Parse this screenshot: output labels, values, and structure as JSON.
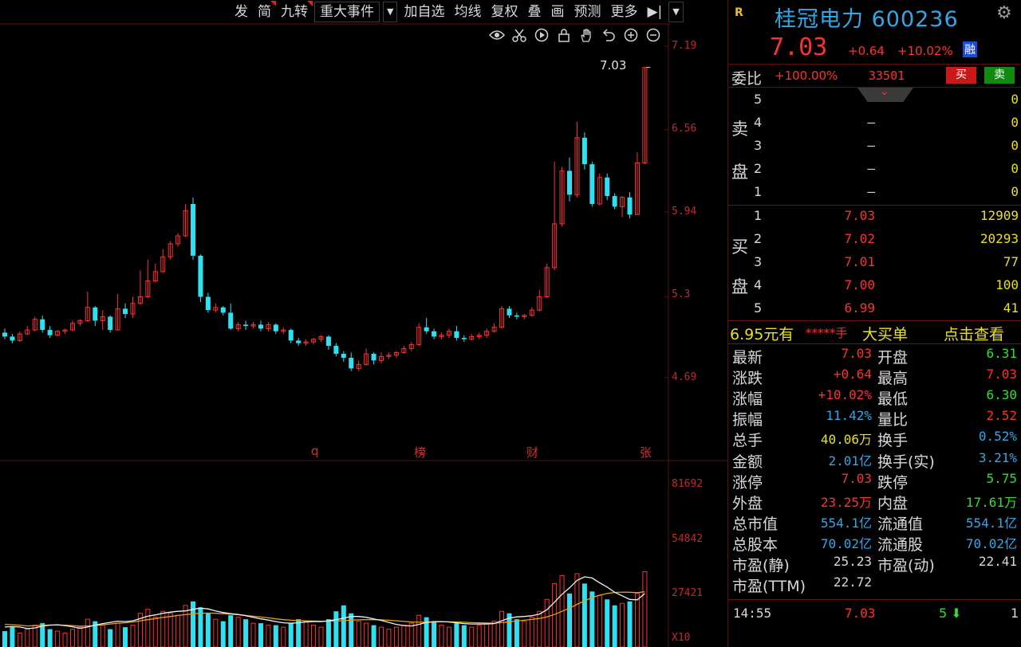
{
  "toolbar": {
    "items": [
      "发",
      "简",
      "九转",
      "重大事件",
      "加自选",
      "均线",
      "复权",
      "叠",
      "画",
      "预测",
      "更多"
    ],
    "dropdown": "▼",
    "jump": "▶|"
  },
  "icons": [
    "eye-icon",
    "scissors-icon",
    "play-icon",
    "lock-icon",
    "hand-icon",
    "undo-icon",
    "zoom-in-icon",
    "zoom-out-icon"
  ],
  "chart_data": {
    "type": "candlestick",
    "price_axis": [
      7.19,
      6.56,
      5.94,
      5.3,
      4.69
    ],
    "volume_axis": [
      "81692",
      "54842",
      "27421",
      "X10"
    ],
    "current_price_tag": "7.03",
    "events": [
      "q",
      "榜",
      "财",
      "张"
    ],
    "candles": [
      [
        5.03,
        5.0,
        5.06,
        4.98
      ],
      [
        5.0,
        4.97,
        5.02,
        4.95
      ],
      [
        4.97,
        5.02,
        5.04,
        4.96
      ],
      [
        5.02,
        5.05,
        5.08,
        5.01
      ],
      [
        5.05,
        5.13,
        5.15,
        5.04
      ],
      [
        5.13,
        5.05,
        5.16,
        5.03
      ],
      [
        5.05,
        5.01,
        5.08,
        4.99
      ],
      [
        5.01,
        5.04,
        5.05,
        5.0
      ],
      [
        5.04,
        5.05,
        5.06,
        5.02
      ],
      [
        5.05,
        5.1,
        5.12,
        5.04
      ],
      [
        5.1,
        5.12,
        5.13,
        5.08
      ],
      [
        5.12,
        5.22,
        5.34,
        5.11
      ],
      [
        5.22,
        5.12,
        5.23,
        5.08
      ],
      [
        5.12,
        5.15,
        5.2,
        5.05
      ],
      [
        5.15,
        5.05,
        5.16,
        5.03
      ],
      [
        5.05,
        5.21,
        5.32,
        5.05
      ],
      [
        5.21,
        5.17,
        5.25,
        5.14
      ],
      [
        5.17,
        5.25,
        5.3,
        5.14
      ],
      [
        5.25,
        5.3,
        5.5,
        5.24
      ],
      [
        5.3,
        5.42,
        5.58,
        5.29
      ],
      [
        5.42,
        5.49,
        5.55,
        5.41
      ],
      [
        5.49,
        5.6,
        5.66,
        5.48
      ],
      [
        5.6,
        5.7,
        5.72,
        5.58
      ],
      [
        5.7,
        5.76,
        5.78,
        5.68
      ],
      [
        5.76,
        5.95,
        6.0,
        5.75
      ],
      [
        6.0,
        5.61,
        6.05,
        5.58
      ],
      [
        5.61,
        5.3,
        5.62,
        5.26
      ],
      [
        5.3,
        5.2,
        5.33,
        5.18
      ],
      [
        5.2,
        5.22,
        5.25,
        5.18
      ],
      [
        5.22,
        5.18,
        5.23,
        5.16
      ],
      [
        5.18,
        5.06,
        5.25,
        5.05
      ],
      [
        5.06,
        5.09,
        5.11,
        5.04
      ],
      [
        5.09,
        5.08,
        5.12,
        5.05
      ],
      [
        5.08,
        5.09,
        5.11,
        5.06
      ],
      [
        5.09,
        5.06,
        5.12,
        5.04
      ],
      [
        5.06,
        5.09,
        5.11,
        5.04
      ],
      [
        5.09,
        5.04,
        5.1,
        5.02
      ],
      [
        5.04,
        5.05,
        5.07,
        5.02
      ],
      [
        5.05,
        4.97,
        5.06,
        4.95
      ],
      [
        4.97,
        4.95,
        4.99,
        4.93
      ],
      [
        4.95,
        4.96,
        4.98,
        4.93
      ],
      [
        4.96,
        4.98,
        4.99,
        4.94
      ],
      [
        4.98,
        5.0,
        5.01,
        4.96
      ],
      [
        5.0,
        4.93,
        5.01,
        4.9
      ],
      [
        4.93,
        4.87,
        4.95,
        4.85
      ],
      [
        4.87,
        4.84,
        4.89,
        4.81
      ],
      [
        4.84,
        4.76,
        4.88,
        4.74
      ],
      [
        4.76,
        4.79,
        4.82,
        4.74
      ],
      [
        4.79,
        4.87,
        4.91,
        4.78
      ],
      [
        4.87,
        4.82,
        4.88,
        4.79
      ],
      [
        4.82,
        4.85,
        4.88,
        4.8
      ],
      [
        4.85,
        4.86,
        4.88,
        4.83
      ],
      [
        4.86,
        4.88,
        4.89,
        4.84
      ],
      [
        4.88,
        4.91,
        4.93,
        4.87
      ],
      [
        4.91,
        4.94,
        4.96,
        4.89
      ],
      [
        4.94,
        5.07,
        5.1,
        4.93
      ],
      [
        5.07,
        5.04,
        5.14,
        5.02
      ],
      [
        5.04,
        5.0,
        5.06,
        4.98
      ],
      [
        5.0,
        5.01,
        5.03,
        4.98
      ],
      [
        5.01,
        5.04,
        5.06,
        4.99
      ],
      [
        5.04,
        4.99,
        5.08,
        4.97
      ],
      [
        4.99,
        4.98,
        5.01,
        4.96
      ],
      [
        4.98,
        5.0,
        5.02,
        4.97
      ],
      [
        5.0,
        5.01,
        5.03,
        4.98
      ],
      [
        5.01,
        5.04,
        5.06,
        4.99
      ],
      [
        5.04,
        5.07,
        5.1,
        5.03
      ],
      [
        5.07,
        5.21,
        5.23,
        5.06
      ],
      [
        5.21,
        5.16,
        5.23,
        5.14
      ],
      [
        5.16,
        5.15,
        5.18,
        5.13
      ],
      [
        5.15,
        5.16,
        5.17,
        5.13
      ],
      [
        5.16,
        5.2,
        5.22,
        5.15
      ],
      [
        5.2,
        5.3,
        5.35,
        5.19
      ],
      [
        5.3,
        5.52,
        5.55,
        5.29
      ],
      [
        5.52,
        5.85,
        6.32,
        5.5
      ],
      [
        5.85,
        6.25,
        6.28,
        5.83
      ],
      [
        6.25,
        6.07,
        6.35,
        6.02
      ],
      [
        6.07,
        6.5,
        6.62,
        6.05
      ],
      [
        6.5,
        6.3,
        6.54,
        6.26
      ],
      [
        6.3,
        6.0,
        6.32,
        5.98
      ],
      [
        6.0,
        6.2,
        6.23,
        5.99
      ],
      [
        6.2,
        6.06,
        6.23,
        6.03
      ],
      [
        6.06,
        5.98,
        6.08,
        5.96
      ],
      [
        5.98,
        6.05,
        6.06,
        5.9
      ],
      [
        6.05,
        5.92,
        6.09,
        5.89
      ],
      [
        5.92,
        6.31,
        6.39,
        5.92
      ],
      [
        6.31,
        7.03,
        7.03,
        6.3
      ]
    ],
    "volumes": [
      8,
      10,
      7,
      9,
      11,
      12,
      9,
      8,
      7,
      9,
      10,
      14,
      13,
      11,
      9,
      12,
      10,
      11,
      17,
      19,
      15,
      18,
      17,
      16,
      21,
      23,
      20,
      17,
      14,
      13,
      16,
      15,
      14,
      12,
      12,
      11,
      11,
      10,
      12,
      14,
      13,
      11,
      10,
      14,
      18,
      21,
      17,
      13,
      12,
      11,
      10,
      9,
      10,
      11,
      12,
      16,
      15,
      13,
      11,
      10,
      12,
      11,
      10,
      11,
      12,
      13,
      18,
      17,
      14,
      13,
      15,
      18,
      24,
      32,
      36,
      27,
      37,
      32,
      28,
      26,
      24,
      21,
      22,
      23,
      27,
      38
    ],
    "ma_short": [
      10.1,
      10.3,
      10.1,
      9.3,
      9.6,
      10.6,
      11.0,
      11.2,
      10.8,
      10.2,
      9.4,
      10.1,
      11.0,
      11.8,
      12.4,
      13.0,
      12.8,
      13.2,
      14.4,
      15.6,
      16.2,
      17.0,
      17.6,
      18.0,
      18.2,
      19.0,
      19.6,
      19.2,
      18.2,
      17.4,
      16.8,
      16.4,
      15.8,
      15.0,
      14.2,
      13.6,
      12.8,
      12.2,
      12.0,
      12.2,
      12.6,
      12.8,
      12.8,
      13.2,
      13.8,
      14.6,
      15.4,
      15.4,
      15.0,
      14.2,
      13.4,
      12.4,
      11.4,
      10.8,
      10.6,
      11.4,
      12.4,
      12.8,
      12.8,
      12.6,
      12.2,
      11.8,
      11.6,
      11.6,
      11.6,
      11.8,
      13.2,
      14.6,
      15.2,
      15.4,
      15.8,
      16.6,
      18.8,
      22.6,
      26.6,
      29.8,
      33.6,
      35.4,
      34.8,
      32.4,
      30.2,
      27.6,
      25.8,
      24.0,
      23.8,
      27.0
    ],
    "ma_long": [
      11.4,
      11.2,
      11.0,
      10.6,
      10.8,
      10.9,
      11.1,
      11.1,
      11.0,
      10.8,
      10.5,
      10.6,
      10.8,
      11.2,
      11.6,
      12.0,
      12.2,
      12.6,
      13.2,
      13.8,
      14.3,
      14.9,
      15.4,
      15.9,
      16.3,
      16.7,
      17.0,
      17.1,
      17.0,
      16.8,
      16.6,
      16.3,
      15.9,
      15.5,
      15.1,
      14.7,
      14.2,
      13.8,
      13.5,
      13.3,
      13.2,
      13.1,
      13.0,
      13.0,
      13.1,
      13.3,
      13.5,
      13.7,
      13.8,
      13.8,
      13.7,
      13.5,
      13.2,
      12.9,
      12.6,
      12.5,
      12.5,
      12.6,
      12.7,
      12.7,
      12.6,
      12.5,
      12.3,
      12.2,
      12.1,
      12.0,
      12.3,
      12.7,
      13.1,
      13.5,
      13.9,
      14.4,
      15.2,
      16.4,
      18.0,
      19.6,
      21.5,
      23.3,
      24.9,
      26.1,
      27.0,
      27.5,
      27.7,
      27.6,
      27.4,
      27.9
    ],
    "volume_scale_max": 45
  },
  "stock": {
    "badge": "R",
    "name": "桂冠电力",
    "code": "600236",
    "price": "7.03",
    "change": "+0.64",
    "change_pct": "+10.02%",
    "tag": "融"
  },
  "weibi": {
    "label": "委比",
    "ratio": "+100.00%",
    "diff": "33501",
    "buy_label": "买",
    "sell_label": "卖",
    "collapse_glyph": "⌄"
  },
  "sell_side_label": [
    "卖",
    "盘"
  ],
  "buy_side_label": [
    "买",
    "盘"
  ],
  "asks": [
    {
      "level": "5",
      "price": "",
      "volume": "0"
    },
    {
      "level": "4",
      "price": "–",
      "volume": "0"
    },
    {
      "level": "3",
      "price": "–",
      "volume": "0"
    },
    {
      "level": "2",
      "price": "–",
      "volume": "0"
    },
    {
      "level": "1",
      "price": "–",
      "volume": "0"
    }
  ],
  "bids": [
    {
      "level": "1",
      "price": "7.03",
      "volume": "12909"
    },
    {
      "level": "2",
      "price": "7.02",
      "volume": "20293"
    },
    {
      "level": "3",
      "price": "7.01",
      "volume": "77"
    },
    {
      "level": "4",
      "price": "7.00",
      "volume": "100"
    },
    {
      "level": "5",
      "price": "6.99",
      "volume": "41"
    }
  ],
  "big_order": {
    "price_text": "6.95元有",
    "masked": "*****手",
    "label": "大买单",
    "link": "点击查看"
  },
  "quote": [
    {
      "k1": "最新",
      "v1": "7.03",
      "c1": "#ff3030",
      "k2": "开盘",
      "v2": "6.31",
      "c2": "#30e030"
    },
    {
      "k1": "涨跌",
      "v1": "+0.64",
      "c1": "#ff3030",
      "k2": "最高",
      "v2": "7.03",
      "c2": "#ff3030"
    },
    {
      "k1": "涨幅",
      "v1": "+10.02%",
      "c1": "#ff3030",
      "k2": "最低",
      "v2": "6.30",
      "c2": "#30e030"
    },
    {
      "k1": "振幅",
      "v1": "11.42%",
      "c1": "#30a8e8",
      "k2": "量比",
      "v2": "2.52",
      "c2": "#ff3030"
    },
    {
      "k1": "总手",
      "v1": "40.06万",
      "c1": "#e8e020",
      "k2": "换手",
      "v2": "0.52%",
      "c2": "#30a8e8"
    },
    {
      "k1": "金额",
      "v1": "2.01亿",
      "c1": "#30a8e8",
      "k2": "换手(实)",
      "v2": "3.21%",
      "c2": "#30a8e8"
    },
    {
      "k1": "涨停",
      "v1": "7.03",
      "c1": "#ff3030",
      "k2": "跌停",
      "v2": "5.75",
      "c2": "#30e030"
    },
    {
      "k1": "外盘",
      "v1": "23.25万",
      "c1": "#ff3030",
      "k2": "内盘",
      "v2": "17.61万",
      "c2": "#30e030"
    },
    {
      "k1": "总市值",
      "v1": "554.1亿",
      "c1": "#30a8e8",
      "k2": "流通值",
      "v2": "554.1亿",
      "c2": "#30a8e8"
    },
    {
      "k1": "总股本",
      "v1": "70.02亿",
      "c1": "#30a8e8",
      "k2": "流通股",
      "v2": "70.02亿",
      "c2": "#30a8e8"
    },
    {
      "k1": "市盈(静)",
      "v1": "25.23",
      "c1": "#d8d8d8",
      "k2": "市盈(动)",
      "v2": "22.41",
      "c2": "#d8d8d8"
    },
    {
      "k1": "市盈(TTM)",
      "v1": "22.72",
      "c1": "#d8d8d8",
      "k2": "",
      "v2": "",
      "c2": "#d8d8d8"
    }
  ],
  "tick": {
    "time": "14:55",
    "price": "7.03",
    "volume": "5",
    "arrow": "⬇",
    "count": "1"
  },
  "colors": {
    "up": "#ff3030",
    "down": "#30e0f0",
    "ma_short": "#f0f0f0",
    "ma_long": "#e8a020",
    "grid": "#5a1010"
  }
}
